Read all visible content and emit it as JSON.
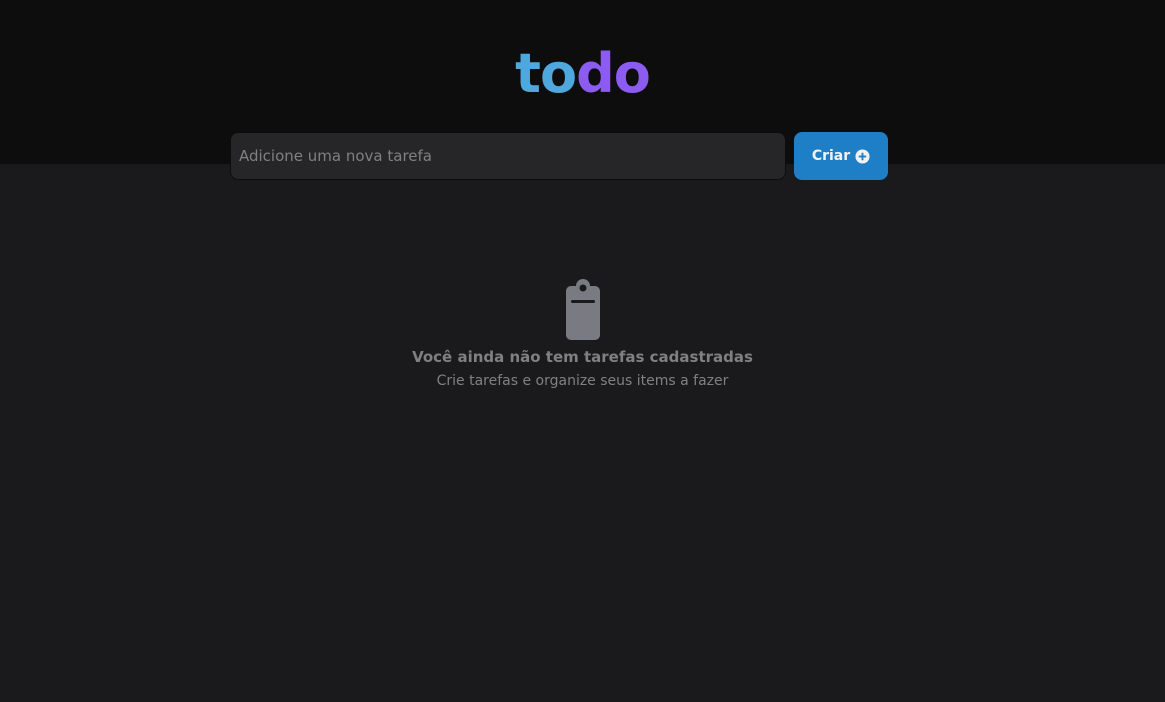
{
  "logo": {
    "part1": "to",
    "part2": "do"
  },
  "new_task": {
    "placeholder": "Adicione uma nova tarefa",
    "value": "",
    "create_label": "Criar",
    "create_icon": "plus-circle-icon"
  },
  "empty_state": {
    "icon": "clipboard-icon",
    "title": "Você ainda não tem tarefas cadastradas",
    "subtitle": "Crie tarefas e organize seus items a fazer"
  },
  "colors": {
    "background": "#1a1a1c",
    "header": "#0d0d0d",
    "input": "#262628",
    "accent_blue": "#1e7fc6",
    "logo_to": "#4ea8de",
    "logo_do": "#8c5cf2",
    "muted_text": "#808080"
  }
}
